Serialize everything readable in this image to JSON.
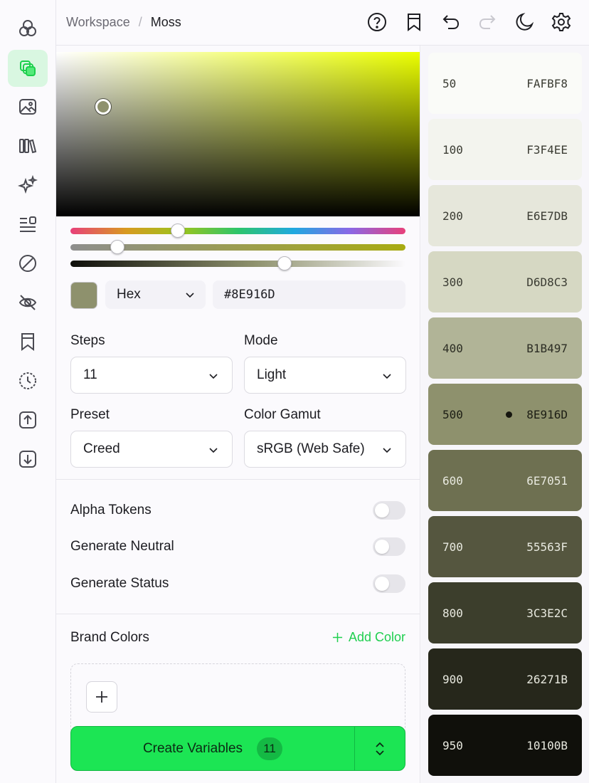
{
  "breadcrumb": {
    "root": "Workspace",
    "separator": "/",
    "current": "Moss"
  },
  "rail_icons": [
    "palette-icon",
    "layers-icon",
    "image-icon",
    "library-icon",
    "sparkle-icon",
    "list-icon",
    "slash-circle-icon",
    "eye-off-icon",
    "bookmark-icon",
    "history-icon",
    "upload-icon",
    "download-icon"
  ],
  "topbar_icons": [
    "help-icon",
    "bookmark-icon",
    "undo-icon",
    "redo-icon",
    "moon-icon",
    "settings-icon"
  ],
  "color": {
    "format": "Hex",
    "value": "#8E916D",
    "swatch": "#8e916d"
  },
  "sliders": {
    "hue": 0.32,
    "saturation": 0.14,
    "lightness": 0.64
  },
  "fields": {
    "steps": {
      "label": "Steps",
      "value": "11"
    },
    "mode": {
      "label": "Mode",
      "value": "Light"
    },
    "preset": {
      "label": "Preset",
      "value": "Creed"
    },
    "gamut": {
      "label": "Color Gamut",
      "value": "sRGB (Web Safe)"
    }
  },
  "toggles": [
    {
      "label": "Alpha Tokens",
      "on": false
    },
    {
      "label": "Generate Neutral",
      "on": false
    },
    {
      "label": "Generate Status",
      "on": false
    }
  ],
  "brand": {
    "title": "Brand Colors",
    "add_label": "Add Color"
  },
  "create": {
    "label": "Create Variables",
    "count": "11"
  },
  "scale": [
    {
      "step": "50",
      "hex": "FAFBF8",
      "bg": "#fafbf8",
      "fg": "#3b3c33"
    },
    {
      "step": "100",
      "hex": "F3F4EE",
      "bg": "#f3f4ee",
      "fg": "#3b3c33"
    },
    {
      "step": "200",
      "hex": "E6E7DB",
      "bg": "#e6e7db",
      "fg": "#3b3c33"
    },
    {
      "step": "300",
      "hex": "D6D8C3",
      "bg": "#d6d8c3",
      "fg": "#3b3c33"
    },
    {
      "step": "400",
      "hex": "B1B497",
      "bg": "#b1b497",
      "fg": "#2c2d24"
    },
    {
      "step": "500",
      "hex": "8E916D",
      "bg": "#8e916d",
      "fg": "#1d1e15",
      "selected": true
    },
    {
      "step": "600",
      "hex": "6E7051",
      "bg": "#6e7051",
      "fg": "#e8e9df"
    },
    {
      "step": "700",
      "hex": "55563F",
      "bg": "#55563f",
      "fg": "#e8e9df"
    },
    {
      "step": "800",
      "hex": "3C3E2C",
      "bg": "#3c3e2c",
      "fg": "#e8e9df"
    },
    {
      "step": "900",
      "hex": "26271B",
      "bg": "#26271b",
      "fg": "#e8e9df"
    },
    {
      "step": "950",
      "hex": "10100B",
      "bg": "#10100b",
      "fg": "#e8e9df"
    }
  ]
}
